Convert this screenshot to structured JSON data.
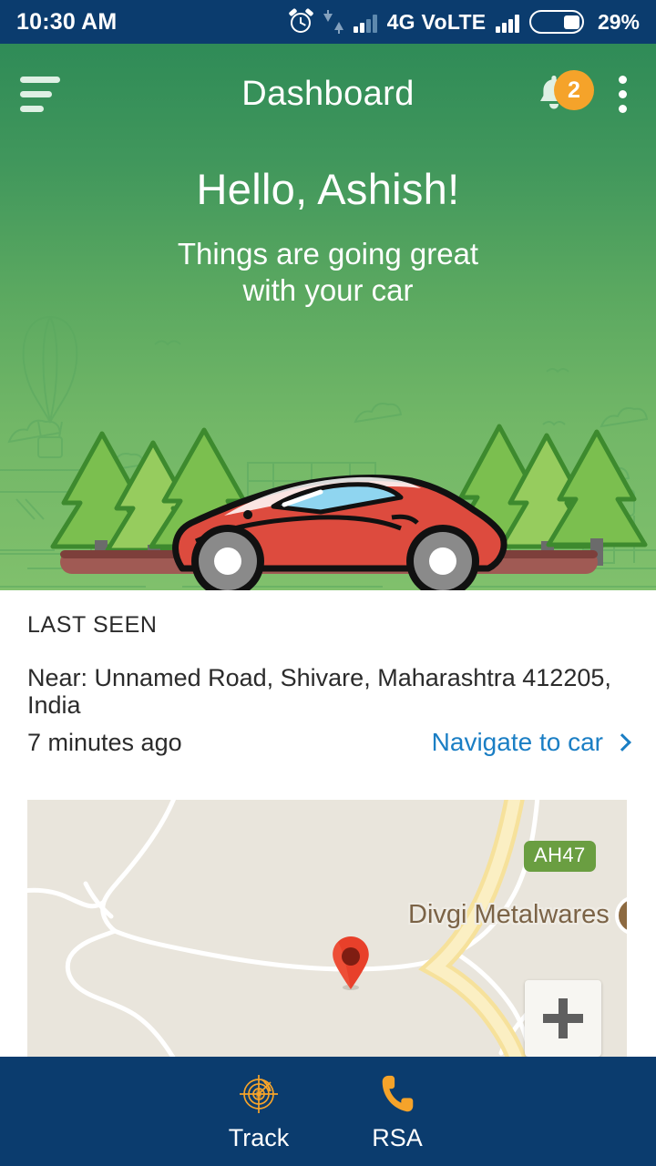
{
  "statusbar": {
    "time": "10:30 AM",
    "network": "4G VoLTE",
    "battery": "29%",
    "icons": [
      "alarm-clock-icon",
      "data-transfer-icon",
      "signal-bars-icon",
      "signal-bars-icon",
      "battery-icon"
    ],
    "background_color": "#0b3c6e"
  },
  "appbar": {
    "title": "Dashboard",
    "menu_icon": "hamburger-menu-icon",
    "notifications_icon": "bell-icon",
    "notifications_count": "2",
    "overflow_icon": "more-vertical-icon",
    "badge_color": "#f5a32a"
  },
  "hero": {
    "greeting": "Hello, Ashish!",
    "subtitle_line1": "Things are going great",
    "subtitle_line2": "with your car",
    "illustration": "red-sports-car-illustration",
    "gradient_from": "#2f8b57",
    "gradient_to": "#80c06c"
  },
  "last_seen": {
    "section_title": "LAST SEEN",
    "address": "Near: Unnamed Road, Shivare, Maharashtra 412205, India",
    "time_ago": "7 minutes ago",
    "navigate_label": "Navigate to car",
    "navigate_icon": "chevron-right-icon",
    "link_color": "#1a7ec4"
  },
  "map": {
    "highway_label": "AH47",
    "poi_label": "Divgi Metalwares",
    "marker_icon": "map-pin-icon",
    "zoom_in_label": "+",
    "background_color": "#e9e5dc",
    "highway_color": "#f7e6a4",
    "road_color": "#ffffff"
  },
  "bottom_nav": {
    "background_color": "#0b3c6e",
    "items": [
      {
        "label": "Track",
        "icon": "radar-target-icon"
      },
      {
        "label": "RSA",
        "icon": "phone-call-icon"
      }
    ],
    "icon_color": "#f5a32a"
  }
}
